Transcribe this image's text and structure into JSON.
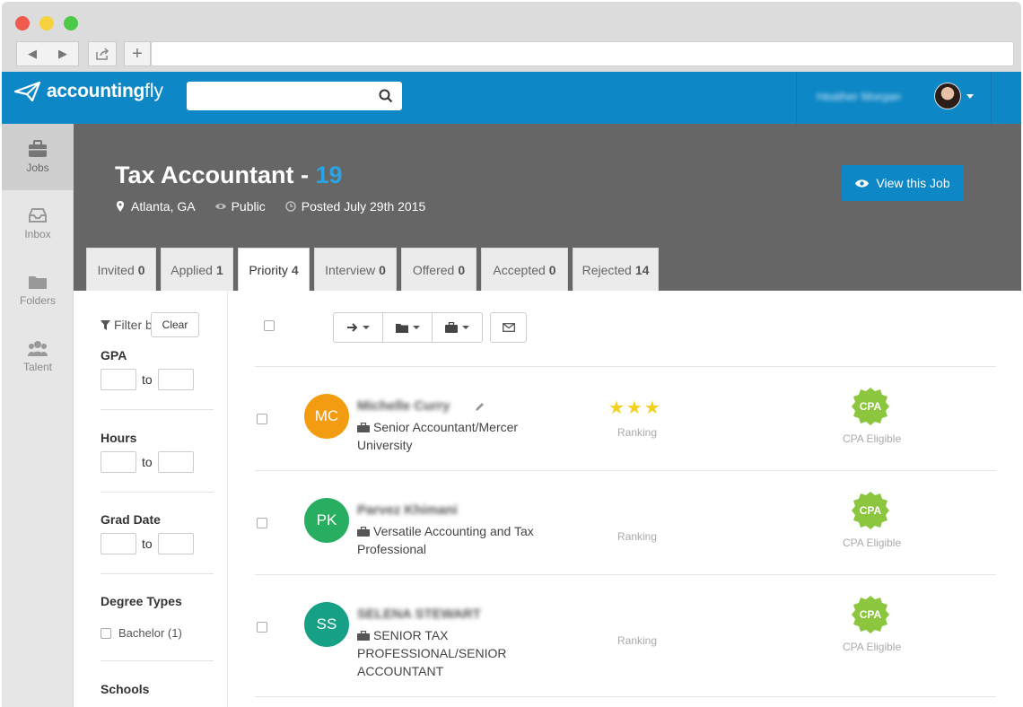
{
  "browser": {
    "back": "◀",
    "forward": "▶",
    "plus": "+"
  },
  "app": {
    "logo_bold": "accounting",
    "logo_light": "fly",
    "search_placeholder": "",
    "user_name": "Heather Morgan"
  },
  "sidebar": {
    "items": [
      {
        "label": "Jobs",
        "icon": "briefcase-icon",
        "active": true
      },
      {
        "label": "Inbox",
        "icon": "inbox-icon",
        "active": false
      },
      {
        "label": "Folders",
        "icon": "folder-icon",
        "active": false
      },
      {
        "label": "Talent",
        "icon": "users-icon",
        "active": false
      }
    ]
  },
  "job": {
    "title": "Tax Accountant - ",
    "count": "19",
    "location": "Atlanta, GA",
    "visibility": "Public",
    "posted": "Posted July 29th 2015",
    "view_button": "View this Job"
  },
  "tabs": [
    {
      "label": "Invited",
      "count": "0"
    },
    {
      "label": "Applied",
      "count": "1"
    },
    {
      "label": "Priority",
      "count": "4",
      "active": true
    },
    {
      "label": "Interview",
      "count": "0"
    },
    {
      "label": "Offered",
      "count": "0"
    },
    {
      "label": "Accepted",
      "count": "0"
    },
    {
      "label": "Rejected",
      "count": "14"
    }
  ],
  "filters": {
    "filter_label": "Filter b",
    "clear_label": "Clear",
    "gpa": "GPA",
    "hours": "Hours",
    "grad_date": "Grad Date",
    "to": "to",
    "degree_types": "Degree Types",
    "bachelor": "Bachelor (1)",
    "schools": "Schools"
  },
  "candidates": [
    {
      "initials": "MC",
      "color": "#f39c12",
      "name": "Michelle Curry",
      "headline": "Senior Accountant/Mercer University",
      "stars": "★★★",
      "ranking_label": "Ranking",
      "cpa": "CPA",
      "cpa_label": "CPA Eligible"
    },
    {
      "initials": "PK",
      "color": "#27ae60",
      "name": "Parvez Khimani",
      "headline": "Versatile Accounting and Tax Professional",
      "stars": "",
      "ranking_label": "Ranking",
      "cpa": "CPA",
      "cpa_label": "CPA Eligible"
    },
    {
      "initials": "SS",
      "color": "#16a085",
      "name": "SELENA STEWART",
      "headline": "SENIOR TAX PROFESSIONAL/SENIOR ACCOUNTANT",
      "stars": "",
      "ranking_label": "Ranking",
      "cpa": "CPA",
      "cpa_label": "CPA Eligible"
    }
  ],
  "colors": {
    "brand": "#0d87c5",
    "header_bg": "#666666",
    "count_blue": "#2aa3e3",
    "cpa_green": "#8cc63f",
    "star": "#f2d01b"
  }
}
